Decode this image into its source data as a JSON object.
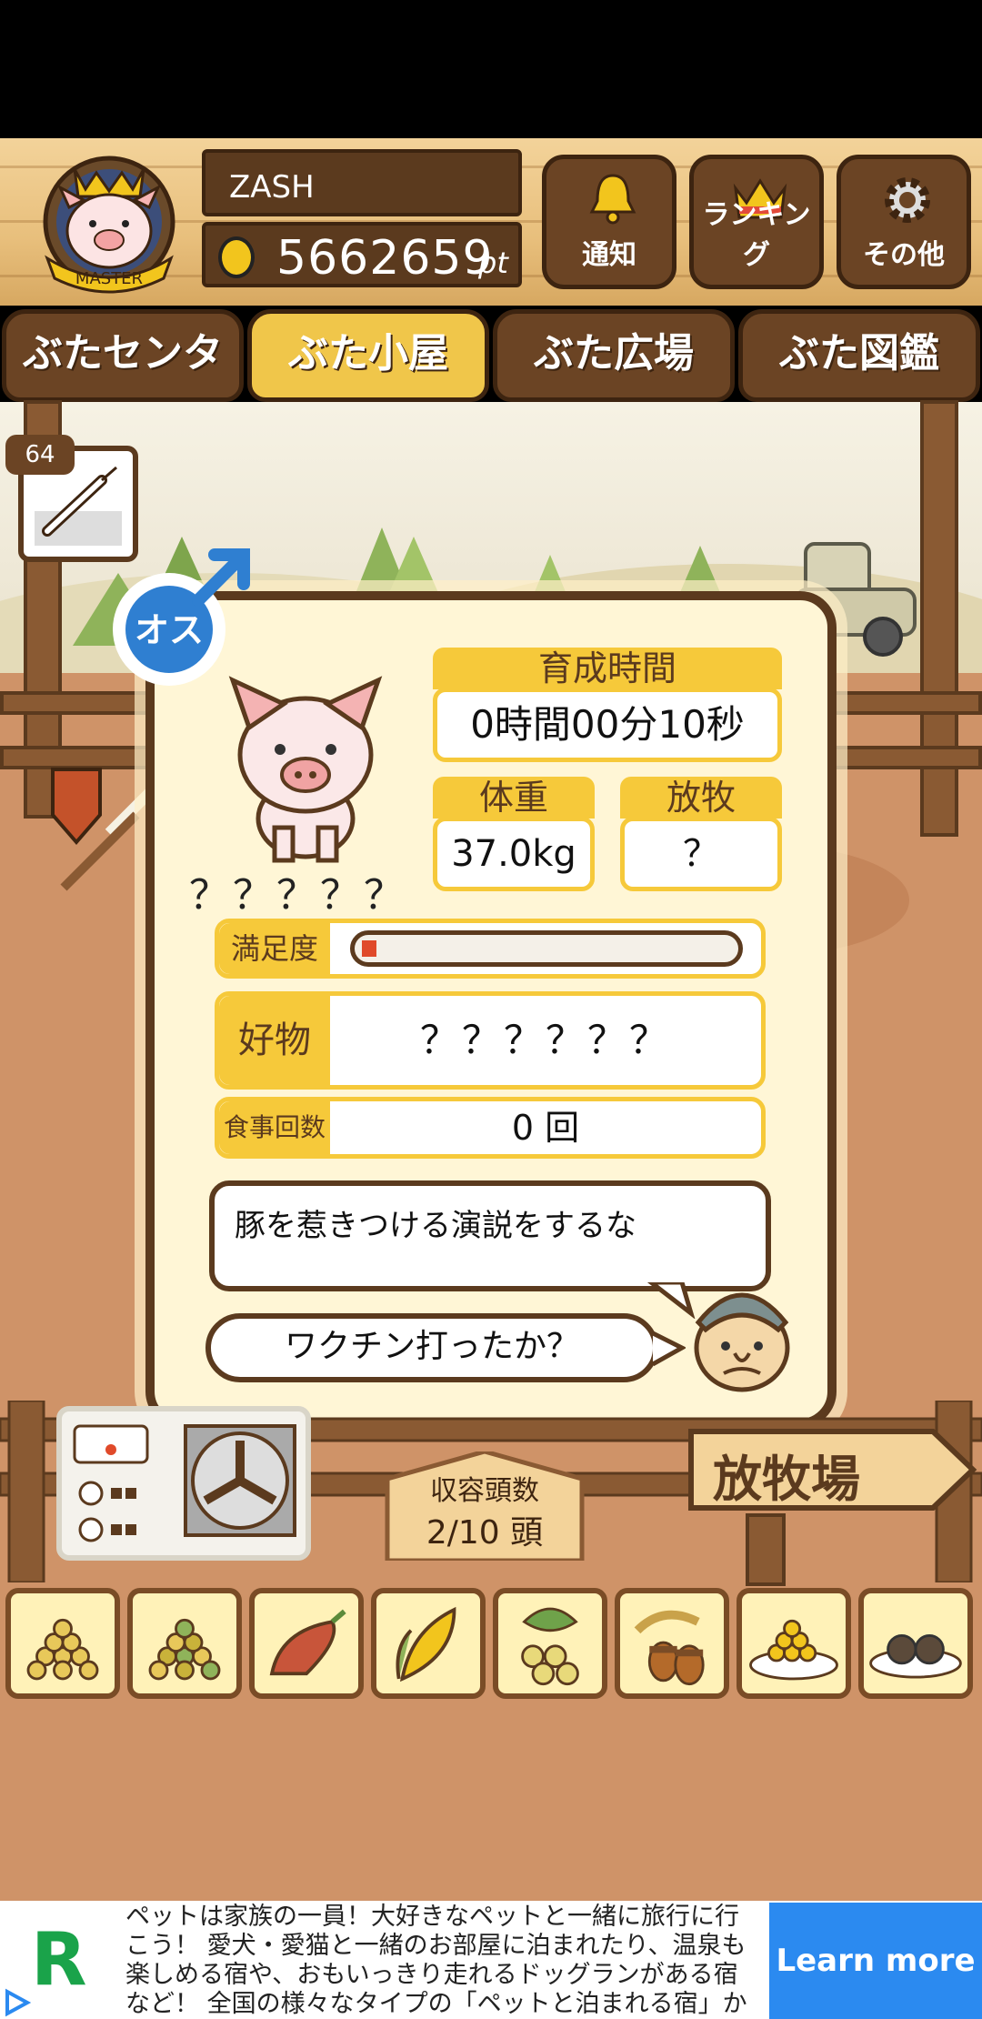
{
  "header": {
    "player_name": "ZASH",
    "points": "5662659",
    "points_unit": "pt",
    "badge_text": "MASTER",
    "buttons": [
      {
        "label": "通知",
        "icon": "bell-icon"
      },
      {
        "label": "ランキング",
        "icon": "crown-icon"
      },
      {
        "label": "その他",
        "icon": "gear-icon"
      }
    ]
  },
  "tabs": [
    {
      "label": "ぶたセンター",
      "active": false
    },
    {
      "label": "ぶた小屋",
      "active": true
    },
    {
      "label": "ぶた広場",
      "active": false
    },
    {
      "label": "ぶた図鑑",
      "active": false
    }
  ],
  "syringe": {
    "count": "64",
    "icon": "syringe-icon"
  },
  "pig_card": {
    "gender_label": "オス",
    "pig_name": "？？？？？",
    "growth_time_label": "育成時間",
    "growth_time_value": "0時間00分10秒",
    "weight_label": "体重",
    "weight_value": "37.0kg",
    "grazing_label": "放牧",
    "grazing_value": "？",
    "satisfaction_label": "満足度",
    "satisfaction_level": 0.04,
    "favorite_label": "好物",
    "favorite_value": "？？？？？？",
    "meals_label": "食事回数",
    "meals_value": "0 回",
    "speech_text": "豚を惹きつける演説をするな",
    "vaccine_button": "ワクチン打ったか？"
  },
  "farm": {
    "capacity_label": "収容頭数",
    "capacity_value": "2/10 頭",
    "grazing_sign": "放牧場"
  },
  "foods": [
    "feed-icon",
    "mixed-feed-icon",
    "sweet-potato-icon",
    "corn-icon",
    "beans-icon",
    "acorn-icon",
    "soybean-plate-icon",
    "truffle-plate-icon"
  ],
  "ad": {
    "text": "ペットは家族の一員！大好きなペットと一緒に旅行に行こう！ 愛犬・愛猫と一緒のお部屋に泊まれたり、温泉も楽しめる宿や、おもいっきり走れるドッグランがある宿など！ 全国の様々なタイプの「ペットと泊まれる宿」から、お好みの宿を見つけよう",
    "button": "Learn more",
    "logo_letter": "R",
    "brand_color": "#2b8af0"
  }
}
